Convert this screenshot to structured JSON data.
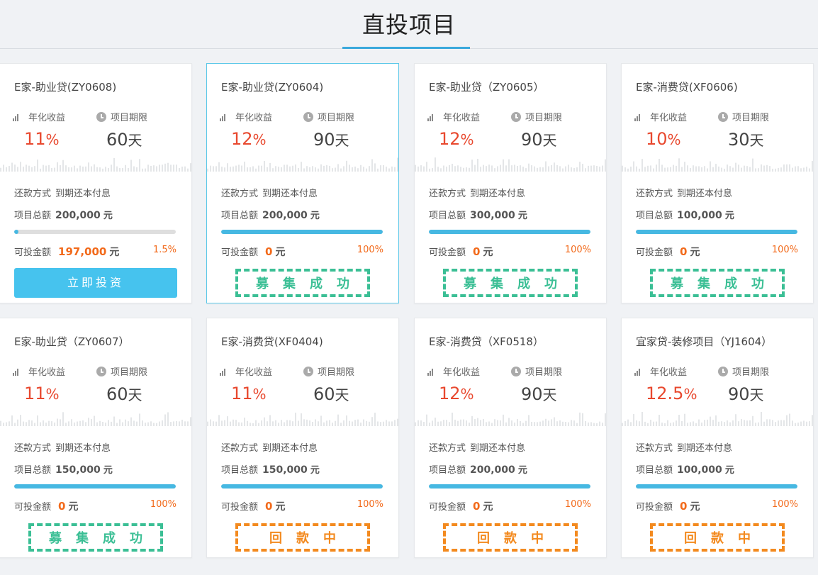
{
  "page": {
    "title": "直投项目"
  },
  "labels": {
    "rate": "年化收益",
    "term": "项目期限",
    "repay": "还款方式",
    "total": "项目总额",
    "avail": "可投金额",
    "rate_unit": "%",
    "term_unit": "天",
    "currency": "元"
  },
  "colors": {
    "accent": "#46c3ee",
    "rate": "#e8482e",
    "orange": "#f26a1b",
    "green_stamp": "#3bbf95",
    "orange_stamp": "#f38a1f"
  },
  "cards": [
    {
      "name": "E家-助业贷(ZY0608)",
      "rate": "11",
      "term": "60",
      "repay": "到期还本付息",
      "total": "200,000",
      "avail": "197,000",
      "percent": "1.5%",
      "progress": 0.015,
      "action": "立即投资",
      "status": ""
    },
    {
      "name": "E家-助业贷(ZY0604)",
      "rate": "12",
      "term": "90",
      "repay": "到期还本付息",
      "total": "200,000",
      "avail": "0",
      "percent": "100%",
      "progress": 1.0,
      "action": "",
      "status": "募集成功"
    },
    {
      "name": "E家-助业贷（ZY0605）",
      "rate": "12",
      "term": "90",
      "repay": "到期还本付息",
      "total": "300,000",
      "avail": "0",
      "percent": "100%",
      "progress": 1.0,
      "action": "",
      "status": "募集成功"
    },
    {
      "name": "E家-消费贷(XF0606)",
      "rate": "10",
      "term": "30",
      "repay": "到期还本付息",
      "total": "100,000",
      "avail": "0",
      "percent": "100%",
      "progress": 1.0,
      "action": "",
      "status": "募集成功"
    },
    {
      "name": "E家-助业贷（ZY0607）",
      "rate": "11",
      "term": "60",
      "repay": "到期还本付息",
      "total": "150,000",
      "avail": "0",
      "percent": "100%",
      "progress": 1.0,
      "action": "",
      "status": "募集成功"
    },
    {
      "name": "E家-消费贷(XF0404)",
      "rate": "11",
      "term": "60",
      "repay": "到期还本付息",
      "total": "150,000",
      "avail": "0",
      "percent": "100%",
      "progress": 1.0,
      "action": "",
      "status": "回款中"
    },
    {
      "name": "E家-消费贷（XF0518）",
      "rate": "12",
      "term": "90",
      "repay": "到期还本付息",
      "total": "200,000",
      "avail": "0",
      "percent": "100%",
      "progress": 1.0,
      "action": "",
      "status": "回款中"
    },
    {
      "name": "宜家贷-装修项目（YJ1604）",
      "rate": "12.5",
      "term": "90",
      "repay": "到期还本付息",
      "total": "100,000",
      "avail": "0",
      "percent": "100%",
      "progress": 1.0,
      "action": "",
      "status": "回款中"
    }
  ]
}
